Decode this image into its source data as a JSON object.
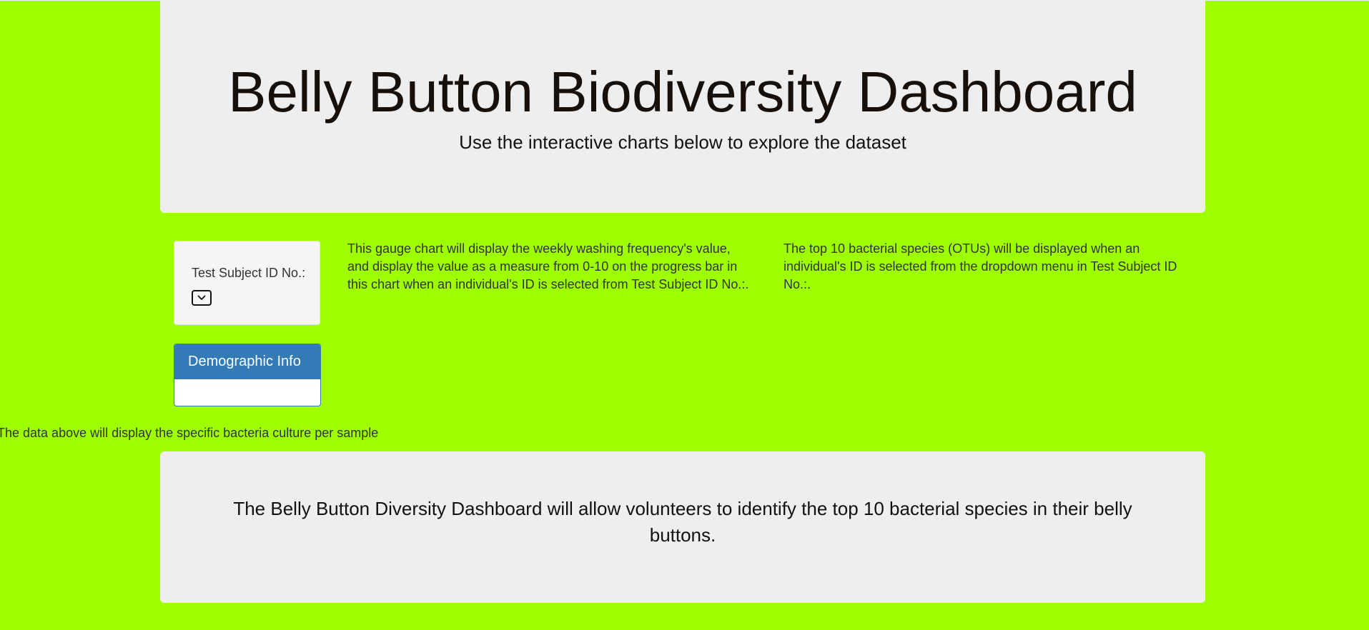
{
  "header": {
    "title": "Belly Button Biodiversity Dashboard",
    "subtitle": "Use the interactive charts below to explore the dataset"
  },
  "selector": {
    "label": "Test Subject ID No.:",
    "selected_value": ""
  },
  "demographic_panel": {
    "heading": "Demographic Info"
  },
  "gauge_description": "This gauge chart will display the weekly washing frequency's value, and display the value as a measure from 0-10 on the progress bar in this chart when an individual's ID is selected from Test Subject ID No.:.",
  "bar_description": "The top 10 bacterial species (OTUs) will be displayed when an individual's ID is selected from the dropdown menu in Test Subject ID No.:.",
  "bubble_description": "The data above will display the specific bacteria culture per sample",
  "footer": {
    "text": "The Belly Button Diversity Dashboard will allow volunteers to identify the top 10 bacterial species in their belly buttons."
  },
  "icons": {
    "dropdown": "chevron-down-icon"
  },
  "colors": {
    "background": "#9dff00",
    "panel_primary": "#337ab7",
    "well": "#eeeeee"
  }
}
